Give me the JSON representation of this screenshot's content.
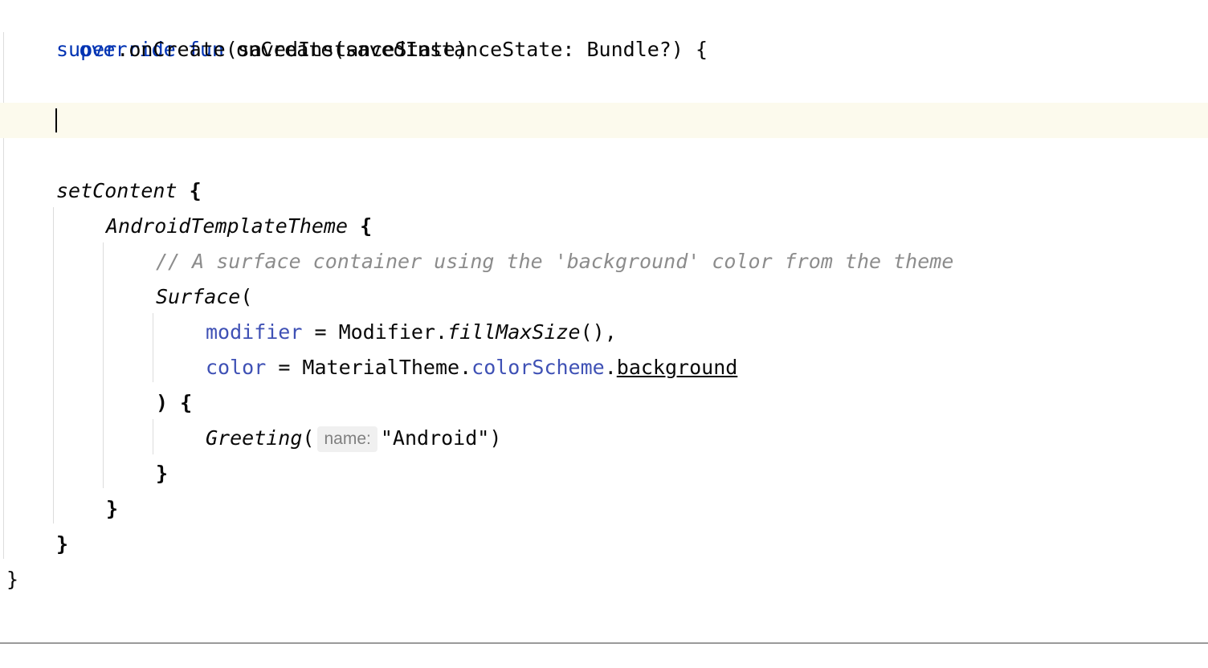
{
  "editor": {
    "lines": [
      {
        "tokens": [
          "override",
          "fun",
          "onCreate(savedInstanceState: Bundle?) {"
        ]
      },
      {
        "tokens": [
          "super",
          ".onCreate(savedInstanceState)"
        ]
      },
      {
        "tokens": []
      },
      {
        "tokens": []
      },
      {
        "tokens": []
      },
      {
        "tokens": [
          "setContent",
          " {"
        ]
      },
      {
        "tokens": [
          "AndroidTemplateTheme",
          " {"
        ]
      },
      {
        "tokens": [
          "// A surface container using the 'background' color from the theme"
        ]
      },
      {
        "tokens": [
          "Surface",
          "("
        ]
      },
      {
        "tokens": [
          "modifier",
          " = Modifier.",
          "fillMaxSize",
          "(),"
        ]
      },
      {
        "tokens": [
          "color",
          " = MaterialTheme.",
          "colorScheme",
          ".",
          "background"
        ]
      },
      {
        "tokens": [
          ") {"
        ]
      },
      {
        "tokens": [
          "Greeting",
          "(",
          "name:",
          "\"Android\"",
          ")"
        ]
      },
      {
        "tokens": [
          "}"
        ]
      },
      {
        "tokens": [
          "}"
        ]
      },
      {
        "tokens": [
          "}"
        ]
      },
      {
        "tokens": [
          "}"
        ]
      }
    ]
  },
  "colors": {
    "keyword": "#0033b3",
    "property": "#871094",
    "named_param": "#3f51b5",
    "comment": "#8c8c8c",
    "string": "#067d17",
    "current_line": "#fcfaed"
  }
}
